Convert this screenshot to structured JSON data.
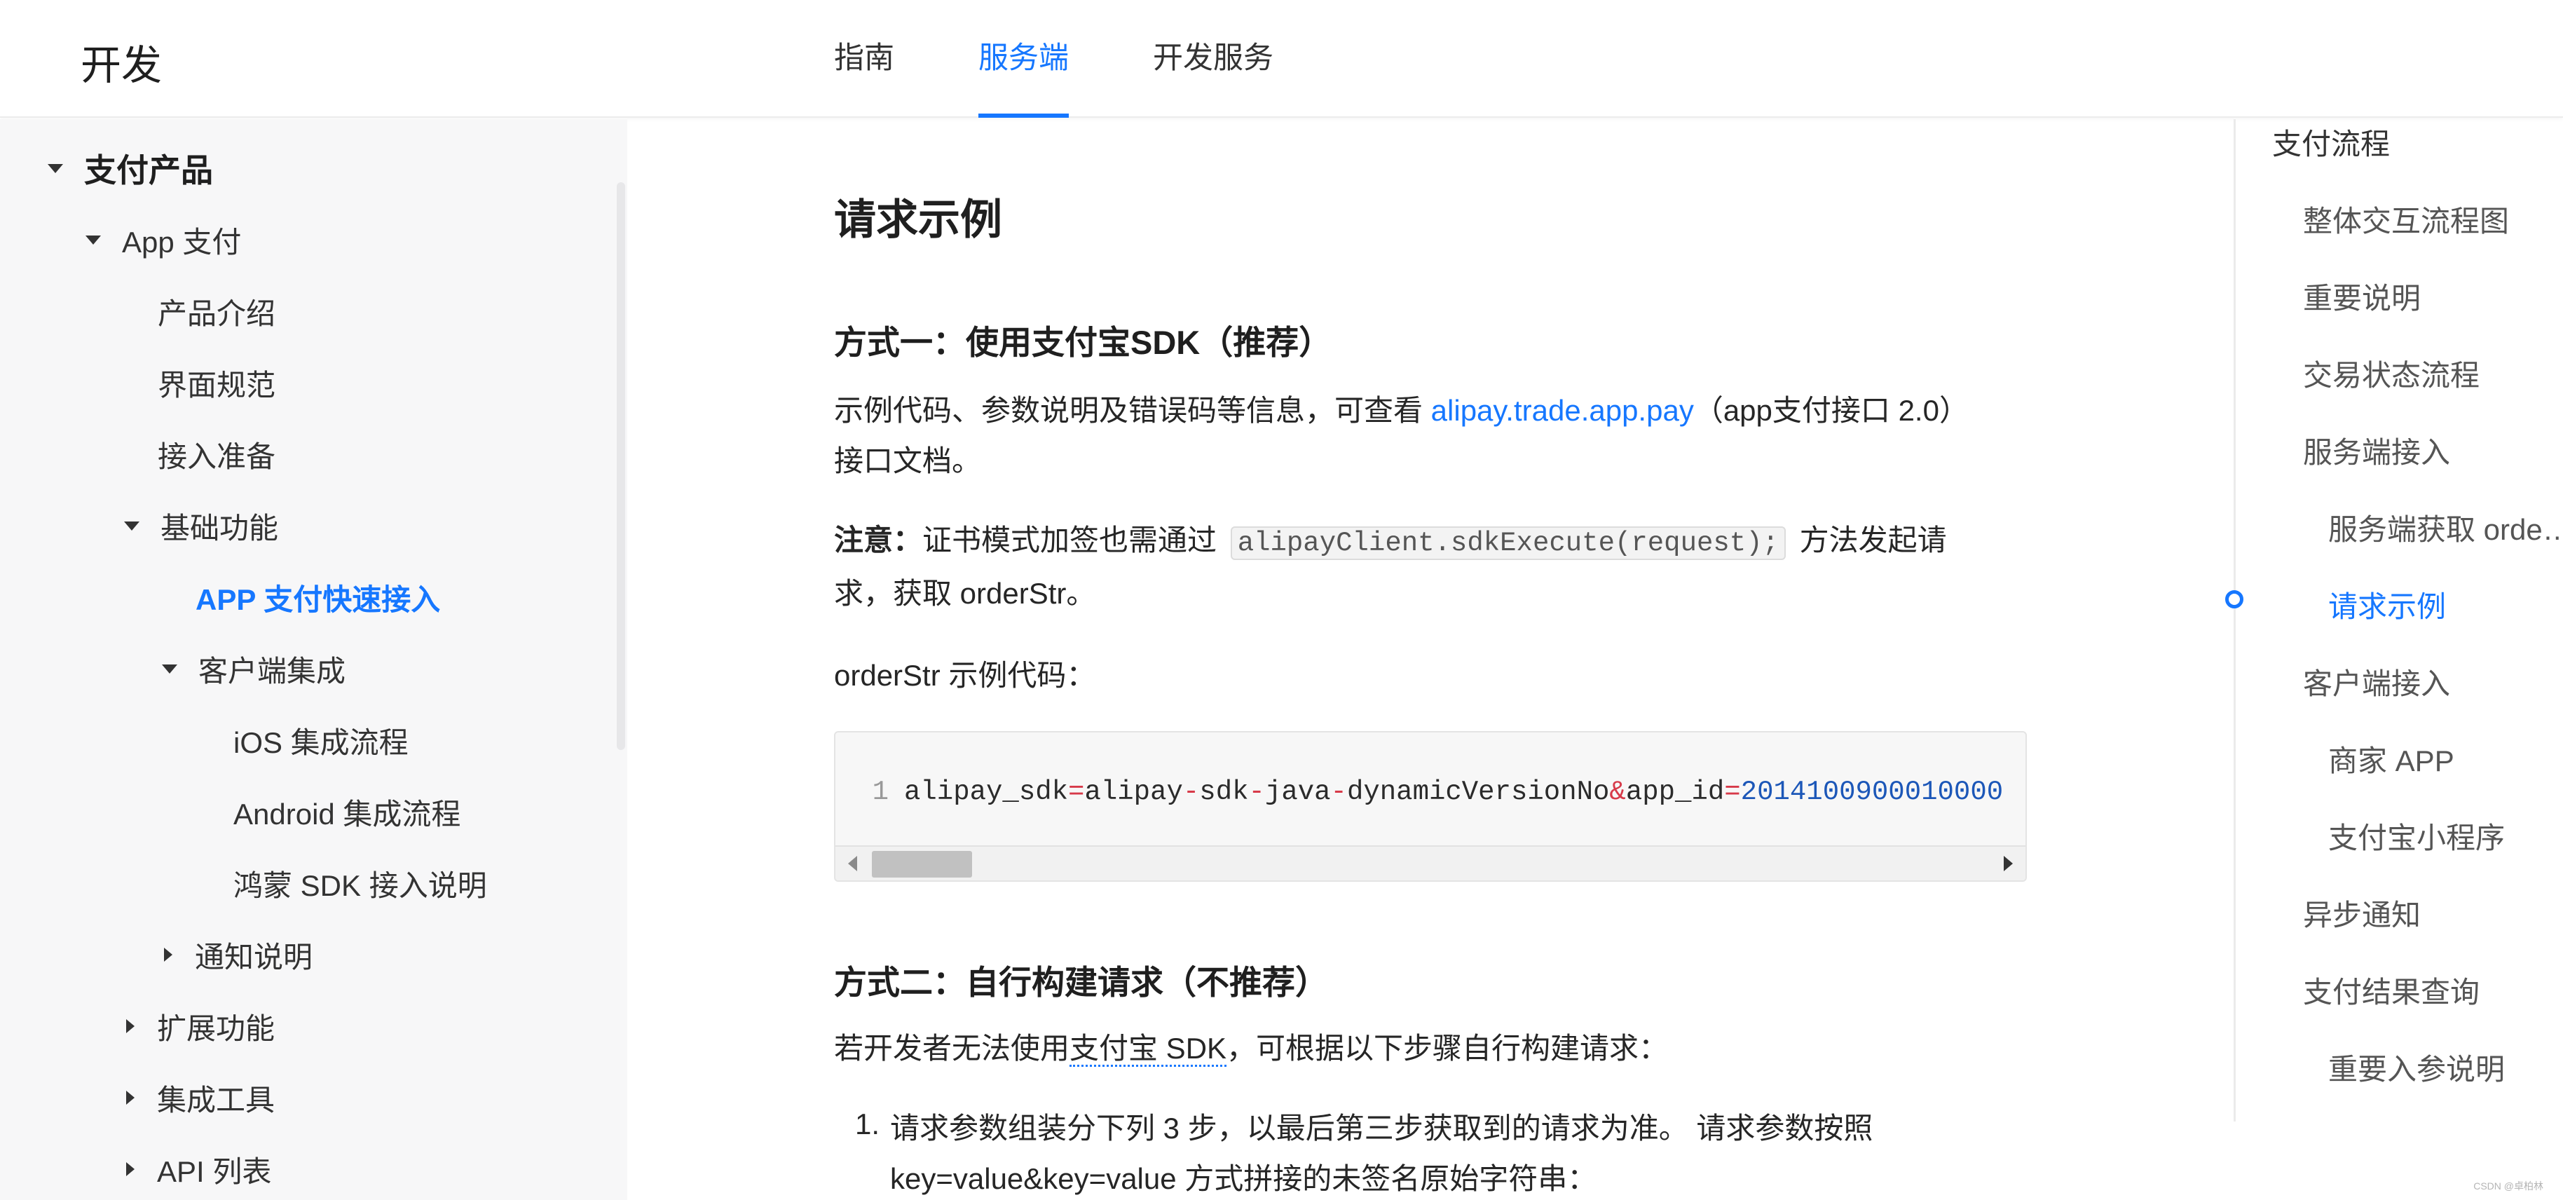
{
  "header": {
    "brand": "开发",
    "tabs": [
      {
        "label": "指南",
        "active": false
      },
      {
        "label": "服务端",
        "active": true
      },
      {
        "label": "开发服务",
        "active": false
      }
    ]
  },
  "sidebar": {
    "items": [
      {
        "label": "支付产品",
        "caret": "down"
      },
      {
        "label": "App 支付",
        "caret": "down"
      },
      {
        "label": "产品介绍"
      },
      {
        "label": "界面规范"
      },
      {
        "label": "接入准备"
      },
      {
        "label": "基础功能",
        "caret": "down"
      },
      {
        "label": "APP 支付快速接入",
        "current": true
      },
      {
        "label": "客户端集成",
        "caret": "down"
      },
      {
        "label": "iOS 集成流程"
      },
      {
        "label": "Android 集成流程"
      },
      {
        "label": "鸿蒙 SDK 接入说明"
      },
      {
        "label": "通知说明",
        "caret": "right"
      },
      {
        "label": "扩展功能",
        "caret": "right"
      },
      {
        "label": "集成工具",
        "caret": "right"
      },
      {
        "label": "API 列表",
        "caret": "right"
      }
    ]
  },
  "content": {
    "title": "请求示例",
    "method1": {
      "heading": "方式一：使用支付宝SDK（推荐）",
      "intro_before": "示例代码、参数说明及错误码等信息，可查看 ",
      "intro_link": "alipay.trade.app.pay",
      "intro_after": "（app支付接口 2.0）接口文档。",
      "note_label": "注意：",
      "note_before": "证书模式加签也需通过 ",
      "note_code": "alipayClient.sdkExecute(request);",
      "note_after": " 方法发起请求，获取 orderStr。",
      "sample_label": "orderStr 示例代码："
    },
    "code": {
      "line_number": "1",
      "tokens": [
        {
          "t": "alipay_sdk",
          "k": "key"
        },
        {
          "t": "=",
          "k": "op"
        },
        {
          "t": "alipay",
          "k": "key"
        },
        {
          "t": "-",
          "k": "op"
        },
        {
          "t": "sdk",
          "k": "key"
        },
        {
          "t": "-",
          "k": "op"
        },
        {
          "t": "java",
          "k": "key"
        },
        {
          "t": "-",
          "k": "op"
        },
        {
          "t": "dynamicVersionNo",
          "k": "key"
        },
        {
          "t": "&",
          "k": "op"
        },
        {
          "t": "app_id",
          "k": "key"
        },
        {
          "t": "=",
          "k": "op"
        },
        {
          "t": "2014100900010000",
          "k": "num"
        }
      ]
    },
    "method2": {
      "heading": "方式二：自行构建请求（不推荐）",
      "intro_before": "若开发者无法使用",
      "intro_link": "支付宝 SDK",
      "intro_after": "，可根据以下步骤自行构建请求：",
      "step_number": "1.",
      "step_text": "请求参数组装分下列 3 步，以最后第三步获取到的请求为准。 请求参数按照 key=value&key=value 方式拼接的未签名原始字符串："
    }
  },
  "toc": {
    "items": [
      {
        "label": "支付流程",
        "level": 0
      },
      {
        "label": "整体交互流程图",
        "level": 1
      },
      {
        "label": "重要说明",
        "level": 1
      },
      {
        "label": "交易状态流程",
        "level": 1
      },
      {
        "label": "服务端接入",
        "level": 1
      },
      {
        "label": "服务端获取 orde…",
        "level": 2
      },
      {
        "label": "请求示例",
        "level": 2,
        "active": true
      },
      {
        "label": "客户端接入",
        "level": 1
      },
      {
        "label": "商家 APP",
        "level": 2
      },
      {
        "label": "支付宝小程序",
        "level": 2
      },
      {
        "label": "异步通知",
        "level": 1
      },
      {
        "label": "支付结果查询",
        "level": 1
      },
      {
        "label": "重要入参说明",
        "level": 2
      }
    ]
  },
  "footer": {
    "watermark": "CSDN @卓柏林"
  },
  "colors": {
    "accent": "#1677ff",
    "sidebar_bg": "#f7f7f8",
    "code_bg": "#f7f7f7",
    "code_operator": "#d73a49",
    "code_number": "#1c57b8"
  }
}
